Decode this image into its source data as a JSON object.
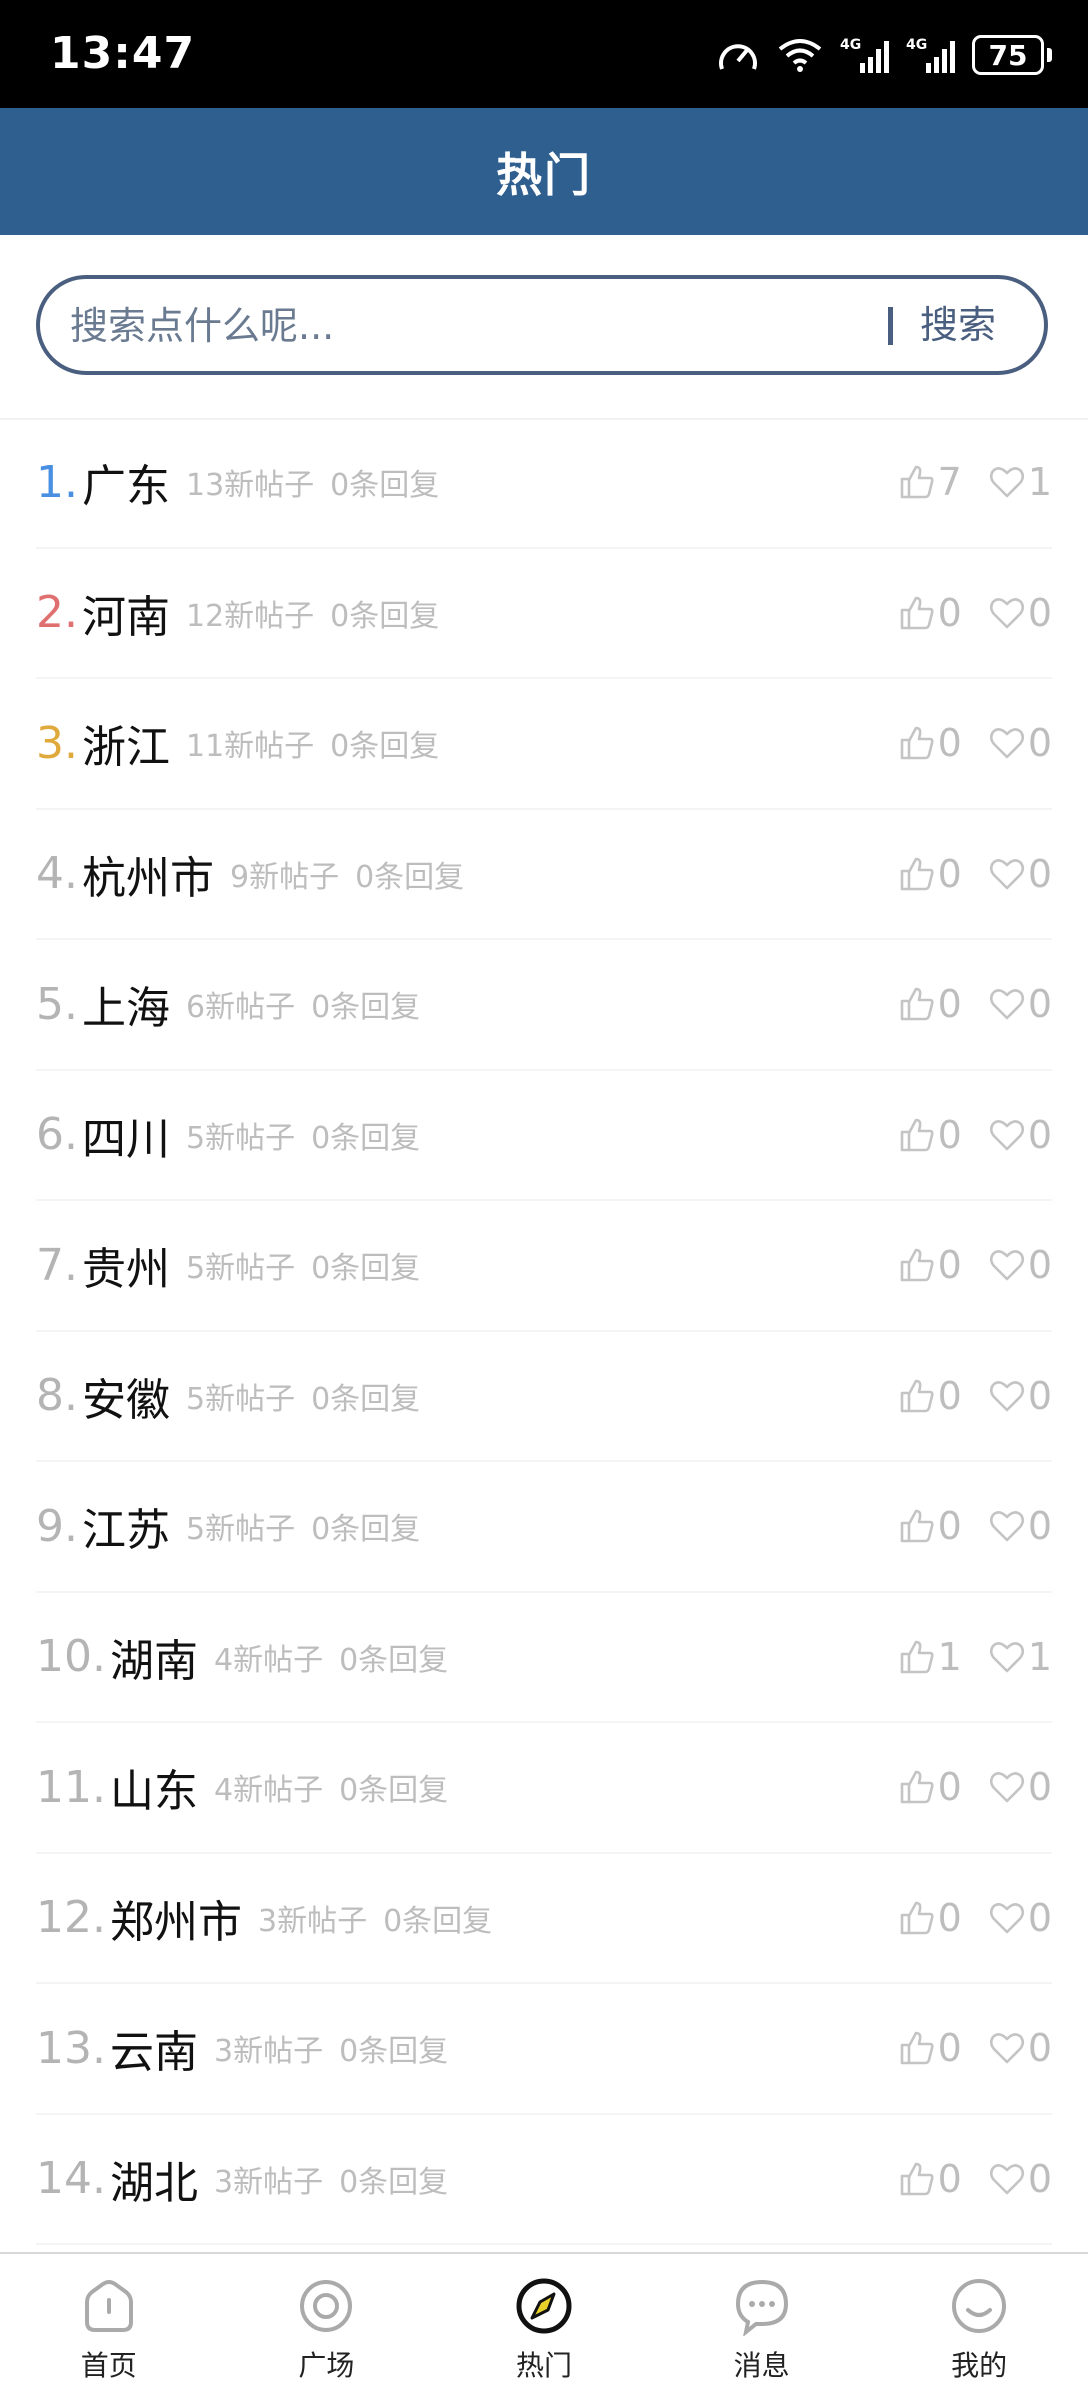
{
  "status": {
    "time": "13:47",
    "battery": "75"
  },
  "header": {
    "title": "热门"
  },
  "search": {
    "placeholder": "搜索点什么呢...",
    "button": "搜索"
  },
  "colors": {
    "rank1": "#4a90e2",
    "rank2": "#e07070",
    "rank3": "#e0a93b",
    "rankDefault": "#b4b4b4",
    "header": "#2f5f8f"
  },
  "list": [
    {
      "rank": "1.",
      "name": "广东",
      "posts": "13新帖子",
      "replies": "0条回复",
      "likes": "7",
      "favs": "1"
    },
    {
      "rank": "2.",
      "name": "河南",
      "posts": "12新帖子",
      "replies": "0条回复",
      "likes": "0",
      "favs": "0"
    },
    {
      "rank": "3.",
      "name": "浙江",
      "posts": "11新帖子",
      "replies": "0条回复",
      "likes": "0",
      "favs": "0"
    },
    {
      "rank": "4.",
      "name": "杭州市",
      "posts": "9新帖子",
      "replies": "0条回复",
      "likes": "0",
      "favs": "0"
    },
    {
      "rank": "5.",
      "name": "上海",
      "posts": "6新帖子",
      "replies": "0条回复",
      "likes": "0",
      "favs": "0"
    },
    {
      "rank": "6.",
      "name": "四川",
      "posts": "5新帖子",
      "replies": "0条回复",
      "likes": "0",
      "favs": "0"
    },
    {
      "rank": "7.",
      "name": "贵州",
      "posts": "5新帖子",
      "replies": "0条回复",
      "likes": "0",
      "favs": "0"
    },
    {
      "rank": "8.",
      "name": "安徽",
      "posts": "5新帖子",
      "replies": "0条回复",
      "likes": "0",
      "favs": "0"
    },
    {
      "rank": "9.",
      "name": "江苏",
      "posts": "5新帖子",
      "replies": "0条回复",
      "likes": "0",
      "favs": "0"
    },
    {
      "rank": "10.",
      "name": "湖南",
      "posts": "4新帖子",
      "replies": "0条回复",
      "likes": "1",
      "favs": "1"
    },
    {
      "rank": "11.",
      "name": "山东",
      "posts": "4新帖子",
      "replies": "0条回复",
      "likes": "0",
      "favs": "0"
    },
    {
      "rank": "12.",
      "name": "郑州市",
      "posts": "3新帖子",
      "replies": "0条回复",
      "likes": "0",
      "favs": "0"
    },
    {
      "rank": "13.",
      "name": "云南",
      "posts": "3新帖子",
      "replies": "0条回复",
      "likes": "0",
      "favs": "0"
    },
    {
      "rank": "14.",
      "name": "湖北",
      "posts": "3新帖子",
      "replies": "0条回复",
      "likes": "0",
      "favs": "0"
    }
  ],
  "tabs": [
    {
      "label": "首页",
      "icon": "home-icon"
    },
    {
      "label": "广场",
      "icon": "circle-icon"
    },
    {
      "label": "热门",
      "icon": "compass-icon"
    },
    {
      "label": "消息",
      "icon": "chat-icon"
    },
    {
      "label": "我的",
      "icon": "smile-icon"
    }
  ]
}
